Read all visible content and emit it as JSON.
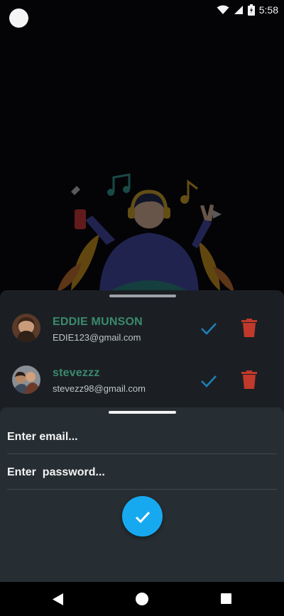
{
  "status_bar": {
    "time": "5:58"
  },
  "accounts": [
    {
      "name": "EDDIE MUNSON",
      "email": "EDIE123@gmail.com"
    },
    {
      "name": "stevezzz",
      "email": "stevezz98@gmail.com"
    }
  ],
  "login": {
    "email_placeholder": "Enter email...",
    "password_placeholder": "Enter  password..."
  },
  "colors": {
    "accent": "#17a9f0",
    "name_green": "#3a8a6e",
    "check_blue": "#1f7fb8",
    "delete_red": "#c0392b"
  },
  "icons": [
    "wifi-icon",
    "signal-icon",
    "battery-icon",
    "check-icon",
    "trash-icon",
    "back-icon",
    "home-icon",
    "recents-icon"
  ]
}
